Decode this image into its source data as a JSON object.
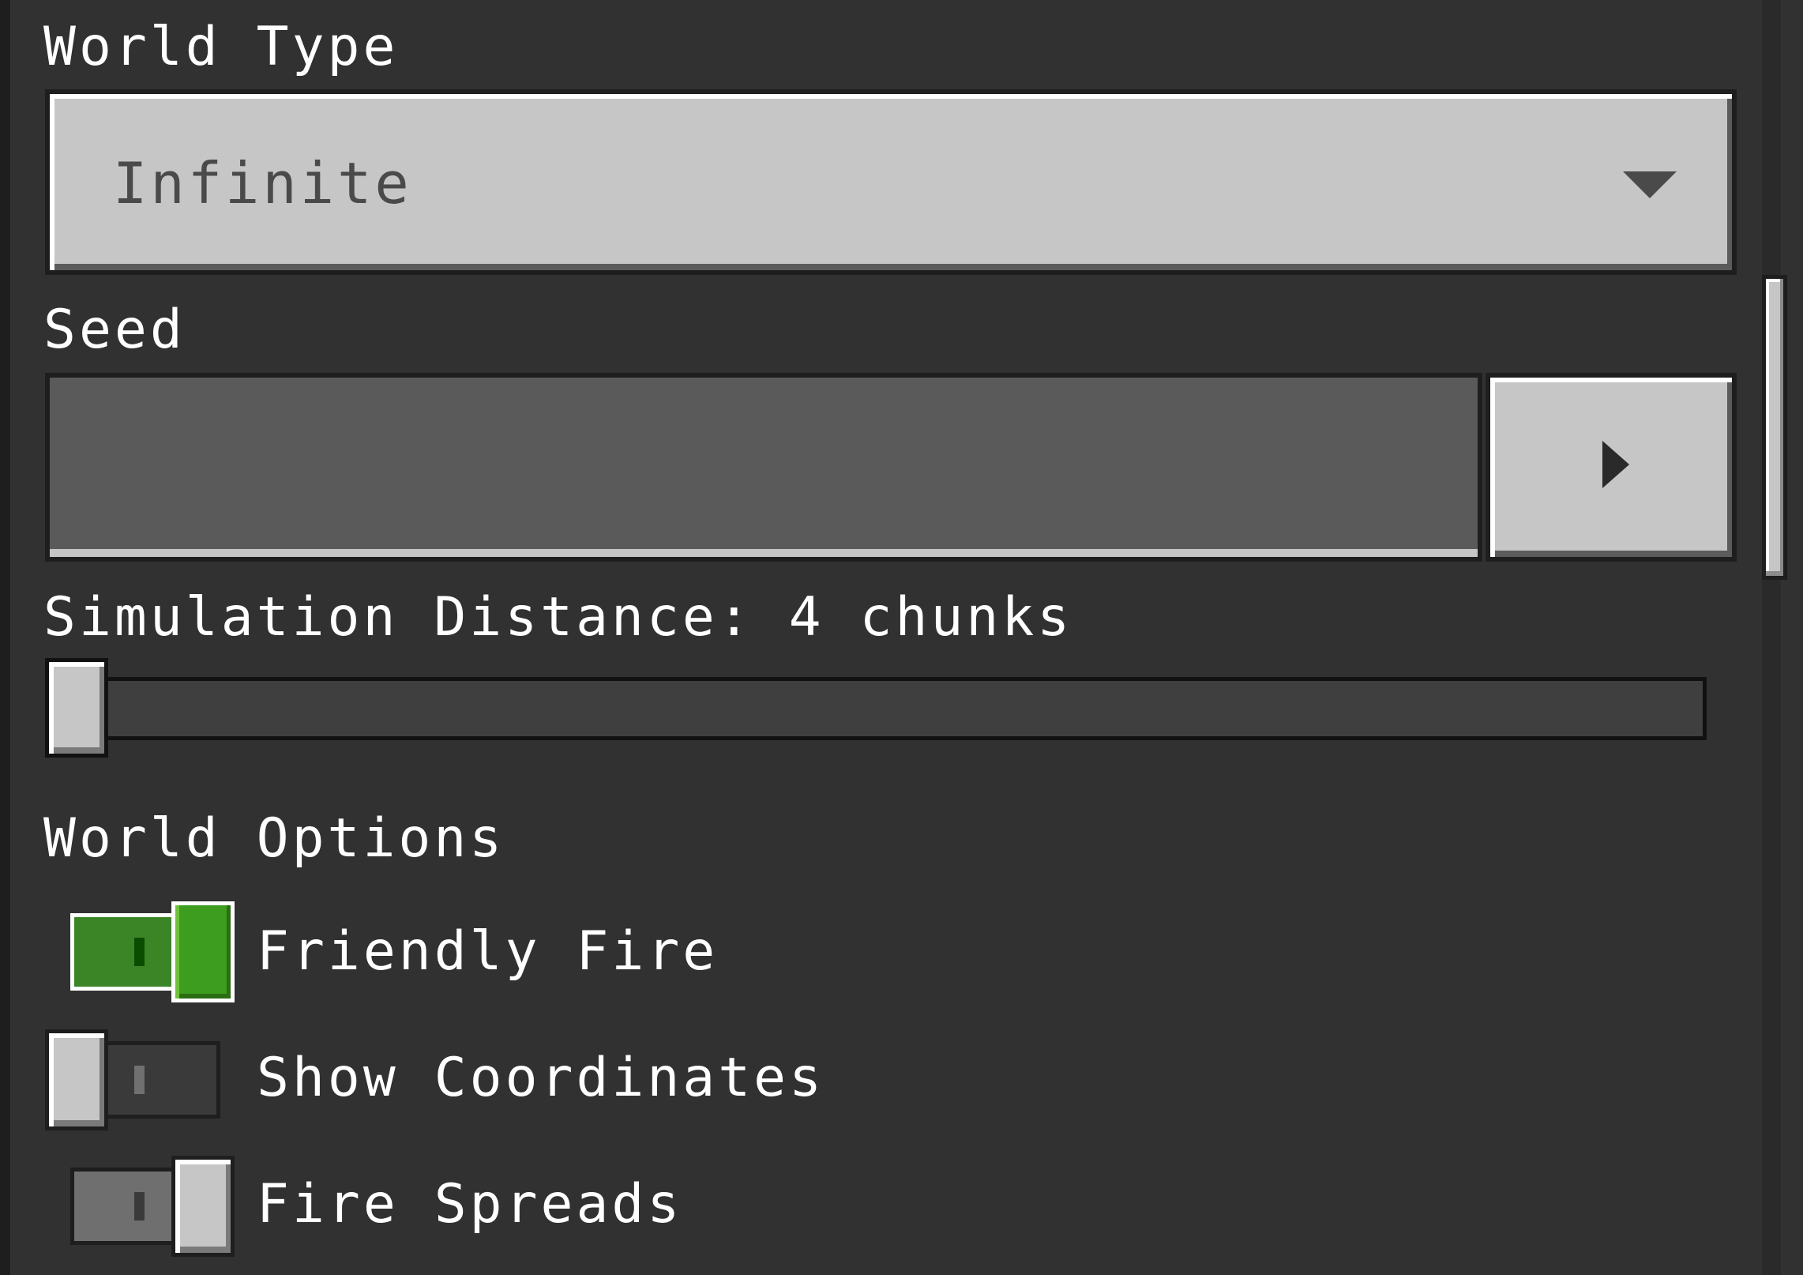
{
  "world_type": {
    "label": "World Type",
    "selected": "Infinite",
    "caret_icon": "chevron-down-icon"
  },
  "seed": {
    "label": "Seed",
    "value": "",
    "button_icon": "play-arrow-icon"
  },
  "simulation_distance": {
    "label": "Simulation Distance: 4 chunks",
    "value": 4,
    "unit": "chunks",
    "level": 0
  },
  "world_options": {
    "heading": "World Options",
    "toggles": [
      {
        "label": "Friendly Fire",
        "state": "on"
      },
      {
        "label": "Show Coordinates",
        "state": "off"
      },
      {
        "label": "Fire Spreads",
        "state": "on-disabled"
      }
    ]
  },
  "colors": {
    "background": "#313131",
    "button": "#c6c6c6",
    "toggle_on": "#3c8527"
  }
}
